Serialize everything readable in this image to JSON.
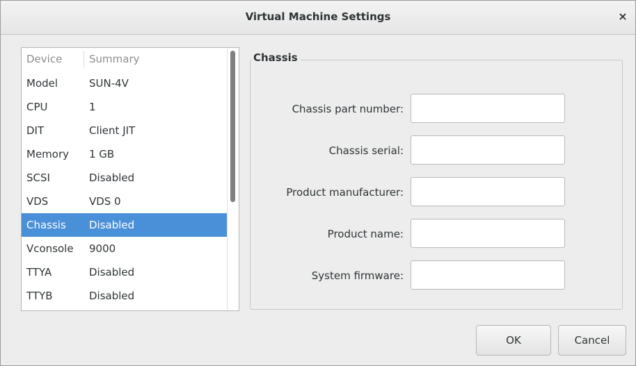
{
  "window": {
    "title": "Virtual Machine Settings",
    "close_glyph": "×"
  },
  "device_list": {
    "columns": {
      "device": "Device",
      "summary": "Summary"
    },
    "rows": [
      {
        "device": "Model",
        "summary": "SUN-4V"
      },
      {
        "device": "CPU",
        "summary": "1"
      },
      {
        "device": "DIT",
        "summary": "Client JIT"
      },
      {
        "device": "Memory",
        "summary": "1 GB"
      },
      {
        "device": "SCSI",
        "summary": "Disabled"
      },
      {
        "device": "VDS",
        "summary": "VDS 0"
      },
      {
        "device": "Chassis",
        "summary": "Disabled",
        "selected": true
      },
      {
        "device": "Vconsole",
        "summary": "9000"
      },
      {
        "device": "TTYA",
        "summary": "Disabled"
      },
      {
        "device": "TTYB",
        "summary": "Disabled"
      }
    ],
    "selected_color": "#4a90d9"
  },
  "chassis": {
    "section_label": "Chassis",
    "fields": [
      {
        "label": "Chassis part number:",
        "value": ""
      },
      {
        "label": "Chassis serial:",
        "value": ""
      },
      {
        "label": "Product manufacturer:",
        "value": ""
      },
      {
        "label": "Product name:",
        "value": ""
      },
      {
        "label": "System firmware:",
        "value": ""
      }
    ]
  },
  "buttons": {
    "ok": "OK",
    "cancel": "Cancel"
  }
}
